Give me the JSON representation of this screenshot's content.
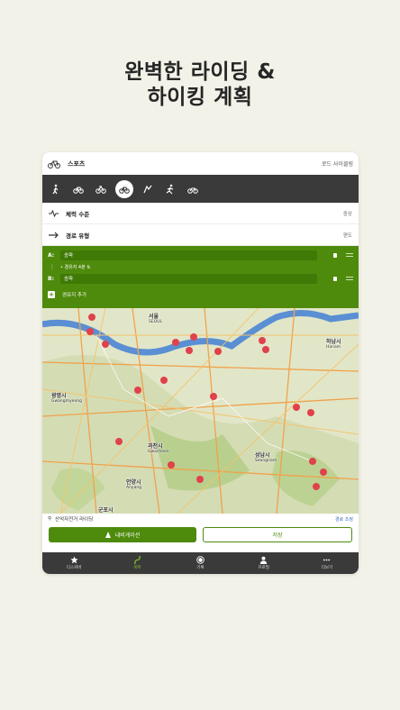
{
  "headline": {
    "line1": "완벽한 라이딩 &",
    "line2": "하이킹 계획"
  },
  "sport": {
    "label": "스포츠",
    "value": "로드 사이클링",
    "icon": "bicycle-icon"
  },
  "activities": [
    {
      "icon": "hiking-icon",
      "selected": false
    },
    {
      "icon": "bicycle-icon",
      "selected": false
    },
    {
      "icon": "mountain-bike-icon",
      "selected": false
    },
    {
      "icon": "road-bike-icon",
      "selected": true
    },
    {
      "icon": "mtb-trail-icon",
      "selected": false
    },
    {
      "icon": "running-icon",
      "selected": false
    },
    {
      "icon": "gravel-bike-icon",
      "selected": false
    }
  ],
  "options": {
    "fitness": {
      "label": "체력 수준",
      "value": "중상",
      "icon": "pulse-icon"
    },
    "route_type": {
      "label": "경로 유형",
      "value": "편도",
      "icon": "one-way-arrow-icon"
    }
  },
  "waypoints": {
    "start": {
      "key": "A:",
      "value": "송파"
    },
    "middle": {
      "time": "• 경유지 4분 ⇅"
    },
    "end": {
      "key": "B:",
      "value": "송파"
    },
    "add_label": "경유지 추가"
  },
  "map": {
    "labels": {
      "seoul": "서울",
      "seoul_en": "SEOUL",
      "hanam": "하남시",
      "hanam_en": "Hanam",
      "gwangmyeong": "광명시",
      "gwangmyeong_en": "Gwangmyeong",
      "gwacheon": "과천시",
      "gwacheon_en": "Gwacheon",
      "seongnam": "성남시",
      "seongnam_en": "Seongnam",
      "anyang": "안양시",
      "anyang_en": "Anyang",
      "gunpo": "군포시"
    }
  },
  "route": {
    "label": "산악자전거 라이딩",
    "link": "경로 조정"
  },
  "buttons": {
    "navigate": "내비게이션",
    "save": "저장"
  },
  "tabs": [
    {
      "label": "디스커버",
      "icon": "star-icon",
      "active": false
    },
    {
      "label": "계획",
      "icon": "plan-route-icon",
      "active": true
    },
    {
      "label": "기록",
      "icon": "record-icon",
      "active": false
    },
    {
      "label": "프로필",
      "icon": "profile-icon",
      "active": false
    },
    {
      "label": "더보기",
      "icon": "more-icon",
      "active": false
    }
  ],
  "colors": {
    "accent": "#4e8a0c",
    "dark": "#3a3a3a",
    "river": "#5a8fd4",
    "marker": "#e0414b"
  }
}
